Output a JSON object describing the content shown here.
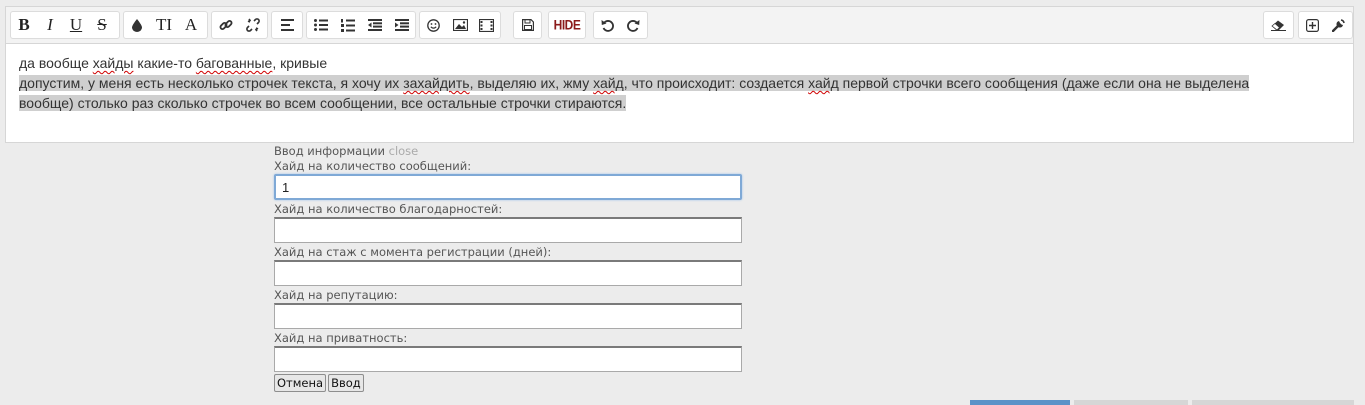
{
  "toolbar": {
    "groups": [
      {
        "id": "format",
        "buttons": [
          "bold-icon",
          "italic-icon",
          "underline-icon",
          "strikethrough-icon"
        ]
      },
      {
        "id": "style",
        "buttons": [
          "color-drop-icon",
          "font-size-icon",
          "font-family-icon"
        ]
      },
      {
        "id": "links",
        "buttons": [
          "link-icon",
          "unlink-icon"
        ]
      },
      {
        "id": "align",
        "buttons": [
          "align-left-icon"
        ]
      },
      {
        "id": "lists",
        "buttons": [
          "bullet-list-icon",
          "numbered-list-icon",
          "outdent-icon",
          "indent-icon"
        ]
      },
      {
        "id": "insert",
        "buttons": [
          "smiley-icon",
          "image-icon",
          "media-icon"
        ]
      },
      {
        "id": "save",
        "buttons": [
          "save-icon"
        ]
      },
      {
        "id": "hide",
        "buttons": [
          "hide-icon"
        ]
      },
      {
        "id": "history",
        "buttons": [
          "undo-icon",
          "redo-icon"
        ]
      },
      {
        "id": "eraser",
        "buttons": [
          "eraser-icon"
        ]
      },
      {
        "id": "tools",
        "buttons": [
          "expand-icon",
          "wrench-icon"
        ]
      }
    ],
    "hide_label": "HIDE",
    "bold_label": "B",
    "italic_label": "I",
    "underline_label": "U",
    "strike_label": "S",
    "fontsize_label": "TI",
    "font_label": "A"
  },
  "editor": {
    "line1": {
      "a": "да вообще ",
      "b": "хайды",
      "c": " какие-то ",
      "d": "багованные",
      "e": ", кривые"
    },
    "line2": {
      "a": "допустим, у меня есть несколько строчек текста, я хочу их ",
      "b": "захайдить",
      "c": ", выделяю их, жму ",
      "d": "хайд",
      "e": ", что происходит: создается ",
      "f": "хайд",
      "g": " первой строчки всего сообщения (даже если она не выделена",
      "h": "вообще) столько раз сколько строчек во всем сообщении, все остальные строчки стираются."
    }
  },
  "form": {
    "title": "Ввод информации",
    "close": "close",
    "fields": [
      {
        "label": "Хайд на количество сообщений:",
        "value": "1"
      },
      {
        "label": "Хайд на количество благодарностей:",
        "value": ""
      },
      {
        "label": "Хайд на стаж с момента регистрации (дней):",
        "value": ""
      },
      {
        "label": "Хайд на репутацию:",
        "value": ""
      },
      {
        "label": "Хайд на приватность:",
        "value": ""
      }
    ],
    "cancel": "Отмена",
    "submit": "Ввод"
  },
  "colors": {
    "accent": "#5b92c8",
    "selection": "#cfcfcf",
    "hide": "#8b1a1a"
  }
}
